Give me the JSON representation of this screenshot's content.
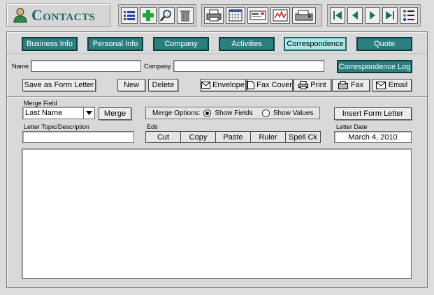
{
  "app": {
    "title": "Contacts"
  },
  "toolbar": {
    "group1": [
      "list-icon",
      "add-icon",
      "search-icon",
      "trash-icon"
    ],
    "group2": [
      "printer-icon",
      "calendar-icon",
      "card-icon",
      "report-icon",
      "fax-machine-icon"
    ],
    "group3": [
      "first-record-icon",
      "previous-record-icon",
      "next-record-icon",
      "last-record-icon",
      "list-view-icon"
    ]
  },
  "tabs": [
    {
      "label": "Business Info"
    },
    {
      "label": "Personal Info"
    },
    {
      "label": "Company"
    },
    {
      "label": "Activities"
    },
    {
      "label": "Correspondence"
    },
    {
      "label": "Quote"
    }
  ],
  "fields": {
    "name_label": "Name",
    "name_value": "",
    "company_label": "Company",
    "company_value": ""
  },
  "buttons": {
    "correspondence_log": "Correspondence Log",
    "save_form_letter": "Save as Form Letter",
    "new": "New",
    "delete": "Delete",
    "envelope": "Envelope",
    "fax_cover": "Fax Cover",
    "print": "Print",
    "fax": "Fax",
    "email": "Email",
    "merge": "Merge",
    "insert_form_letter": "Insert Form Letter"
  },
  "merge": {
    "field_label": "Merge Field",
    "field_value": "Last Name",
    "options_label": "Merge Options:",
    "show_fields": "Show Fields",
    "show_values": "Show Values",
    "selected": "show_fields"
  },
  "letter": {
    "topic_label": "Letter Topic/Description",
    "topic_value": "",
    "edit_label": "Edit",
    "edit_buttons": [
      "Cut",
      "Copy",
      "Paste",
      "Ruler",
      "Spell Ck"
    ],
    "date_label": "Letter Date",
    "date_value": "March 4, 2010",
    "body": ""
  },
  "colors": {
    "tab_active": "#a9e7e7",
    "tab": "#2a8080",
    "title": "#1e6666"
  }
}
